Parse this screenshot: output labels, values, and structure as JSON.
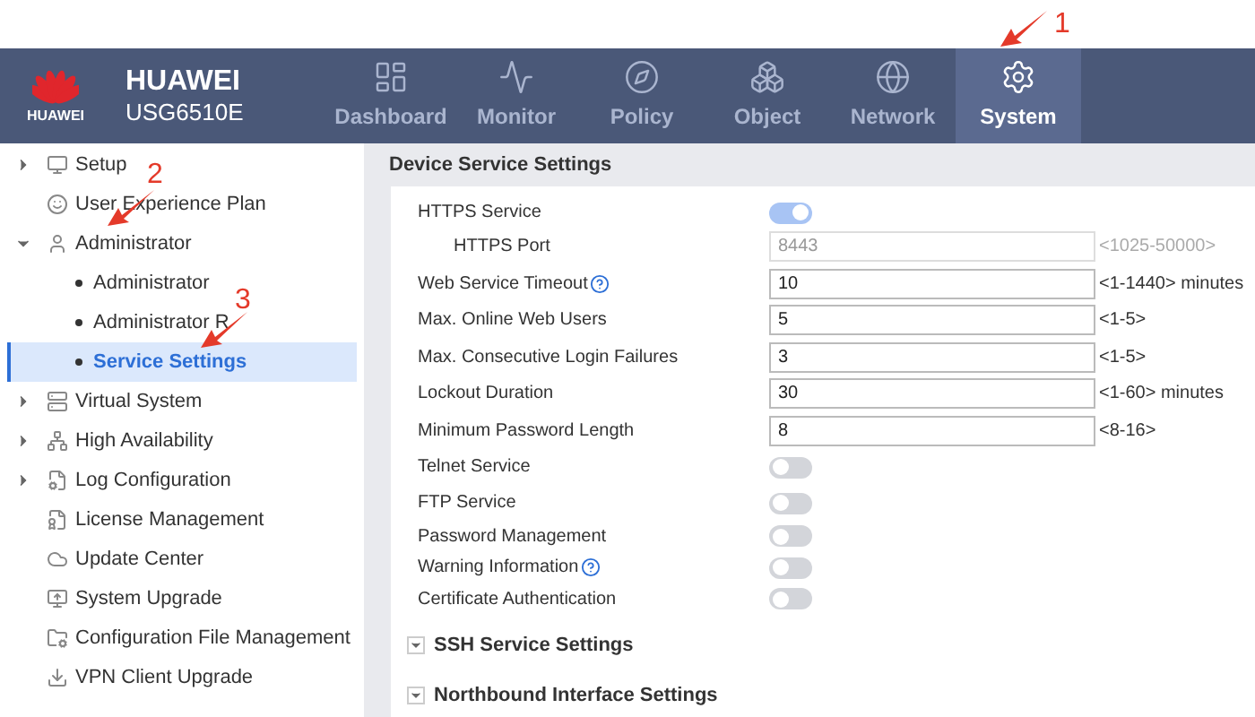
{
  "header": {
    "logo_text": "HUAWEI",
    "brand": "HUAWEI",
    "model": "USG6510E"
  },
  "nav": [
    {
      "label": "Dashboard",
      "selected": false
    },
    {
      "label": "Monitor",
      "selected": false
    },
    {
      "label": "Policy",
      "selected": false
    },
    {
      "label": "Object",
      "selected": false
    },
    {
      "label": "Network",
      "selected": false
    },
    {
      "label": "System",
      "selected": true
    }
  ],
  "sidebar": {
    "items": [
      {
        "label": "Setup",
        "expanded": false,
        "selected": false
      },
      {
        "label": "User Experience Plan",
        "selected": false
      },
      {
        "label": "Administrator",
        "expanded": true,
        "selected": false,
        "children": [
          {
            "label": "Administrator",
            "selected": false
          },
          {
            "label": "Administrator R",
            "selected": false
          },
          {
            "label": "Service Settings",
            "selected": true
          }
        ]
      },
      {
        "label": "Virtual System",
        "expanded": false,
        "selected": false
      },
      {
        "label": "High Availability",
        "expanded": false,
        "selected": false
      },
      {
        "label": "Log Configuration",
        "expanded": false,
        "selected": false
      },
      {
        "label": "License Management",
        "selected": false
      },
      {
        "label": "Update Center",
        "selected": false
      },
      {
        "label": "System Upgrade",
        "selected": false
      },
      {
        "label": "Configuration File Management",
        "selected": false
      },
      {
        "label": "VPN Client Upgrade",
        "selected": false
      }
    ]
  },
  "section": {
    "title": "Device Service Settings",
    "fields": [
      {
        "kind": "toggle",
        "label": "HTTPS Service",
        "on": true,
        "children": [
          {
            "kind": "input",
            "label": "HTTPS Port",
            "value": "8443",
            "hint": "<1025-50000>",
            "disabled": true
          }
        ]
      },
      {
        "kind": "input",
        "label": "Web Service Timeout",
        "value": "10",
        "hint": "<1-1440> minutes",
        "disabled": false,
        "help": true
      },
      {
        "kind": "input",
        "label": "Max. Online Web Users",
        "value": "5",
        "hint": "<1-5>",
        "disabled": false
      },
      {
        "kind": "input",
        "label": "Max. Consecutive Login Failures",
        "value": "3",
        "hint": "<1-5>",
        "disabled": false
      },
      {
        "kind": "input",
        "label": "Lockout Duration",
        "value": "30",
        "hint": "<1-60> minutes",
        "disabled": false
      },
      {
        "kind": "input",
        "label": "Minimum Password Length",
        "value": "8",
        "hint": "<8-16>",
        "disabled": false
      },
      {
        "kind": "toggle",
        "label": "Telnet Service",
        "on": false
      },
      {
        "kind": "toggle",
        "label": "FTP Service",
        "on": false
      },
      {
        "kind": "toggle",
        "label": "Password Management",
        "on": false
      },
      {
        "kind": "toggle",
        "label": "Warning Information",
        "on": false,
        "help": true
      },
      {
        "kind": "toggle",
        "label": "Certificate Authentication",
        "on": false
      }
    ]
  },
  "collapsed_sections": [
    {
      "title": "SSH Service Settings",
      "expanded": false
    },
    {
      "title": "Northbound Interface Settings",
      "expanded": false
    }
  ],
  "annotations": [
    {
      "label": "1"
    },
    {
      "label": "2"
    },
    {
      "label": "3"
    }
  ]
}
